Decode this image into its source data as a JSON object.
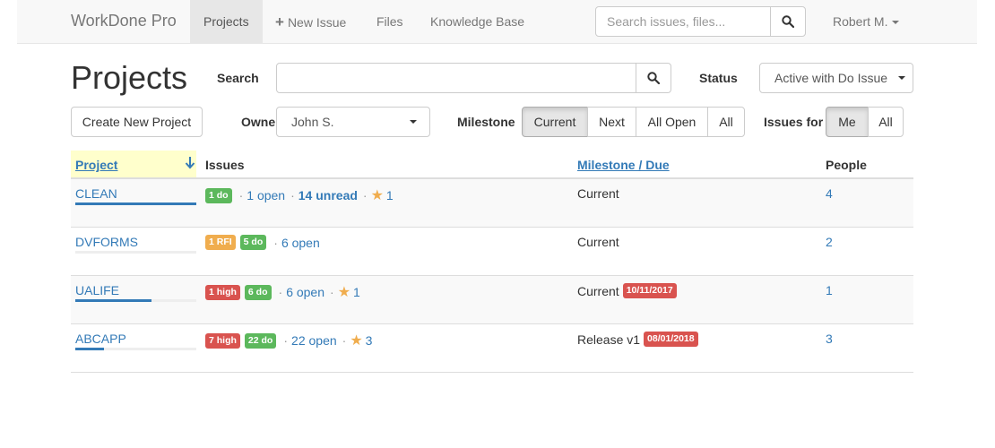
{
  "app": {
    "brand": "WorkDone Pro"
  },
  "nav": {
    "projects": "Projects",
    "new_issue": "New Issue",
    "files": "Files",
    "knowledge_base": "Knowledge Base",
    "search_placeholder": "Search issues, files...",
    "user": "Robert M."
  },
  "page": {
    "title": "Projects"
  },
  "controls": {
    "search_label": "Search",
    "search_value": "",
    "status_label": "Status",
    "status_value": "Active with Do Issue",
    "create_button": "Create New Project",
    "owner_label": "Owner",
    "owner_value": "John S.",
    "milestone_label": "Milestone",
    "milestone_options": [
      "Current",
      "Next",
      "All Open",
      "All"
    ],
    "milestone_selected": "Current",
    "issues_for_label": "Issues for",
    "issues_for_options": [
      "Me",
      "All"
    ],
    "issues_for_selected": "Me"
  },
  "table": {
    "headers": {
      "project": "Project",
      "issues": "Issues",
      "milestone": "Milestone / Due",
      "people": "People"
    },
    "rows": [
      {
        "project": "CLEAN",
        "progress": 1.0,
        "badges": [
          {
            "text": "1 do",
            "color": "green"
          }
        ],
        "open": "1 open",
        "unread": "14 unread",
        "stars": "1",
        "milestone": "Current",
        "due": "",
        "people": "4"
      },
      {
        "project": "DVFORMS",
        "progress": 0.0,
        "badges": [
          {
            "text": "1 RFI",
            "color": "orange"
          },
          {
            "text": "5 do",
            "color": "green"
          }
        ],
        "open": "6 open",
        "unread": "",
        "stars": "",
        "milestone": "Current",
        "due": "",
        "people": "2"
      },
      {
        "project": "UALIFE",
        "progress": 0.63,
        "badges": [
          {
            "text": "1 high",
            "color": "red"
          },
          {
            "text": "6 do",
            "color": "green"
          }
        ],
        "open": "6 open",
        "unread": "",
        "stars": "1",
        "milestone": "Current",
        "due": "10/11/2017",
        "people": "1"
      },
      {
        "project": "ABCAPP",
        "progress": 0.24,
        "badges": [
          {
            "text": "7 high",
            "color": "red"
          },
          {
            "text": "22 do",
            "color": "green"
          }
        ],
        "open": "22 open",
        "unread": "",
        "stars": "3",
        "milestone": "Release v1",
        "due": "08/01/2018",
        "people": "3"
      }
    ]
  },
  "colors": {
    "link": "#337ab7",
    "green": "#5cb85c",
    "orange": "#f0ad4e",
    "red": "#d9534f",
    "sort_highlight": "#ffffcc"
  }
}
